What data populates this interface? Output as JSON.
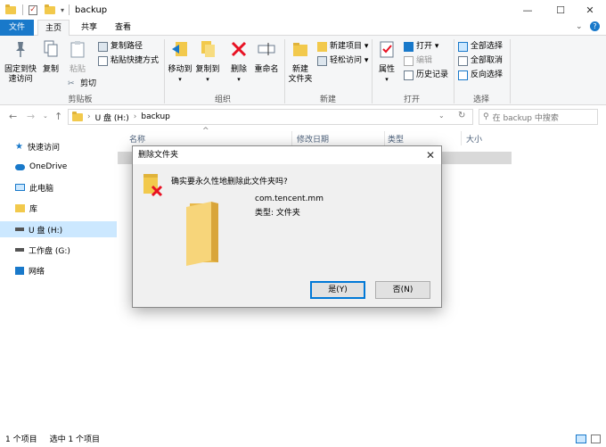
{
  "window": {
    "title": "backup",
    "controls": {
      "minimize": "—",
      "maximize": "☐",
      "close": "✕"
    }
  },
  "ribbon_tabs": {
    "file": "文件",
    "home": "主页",
    "share": "共享",
    "view": "查看"
  },
  "ribbon": {
    "clipboard": {
      "pin": "固定到快\n速访问",
      "copy": "复制",
      "paste": "粘贴",
      "cut": "剪切",
      "copy_path": "复制路径",
      "paste_shortcut": "粘贴快捷方式",
      "label": "剪贴板"
    },
    "organize": {
      "move_to": "移动到",
      "copy_to": "复制到",
      "delete": "删除",
      "rename": "重命名",
      "label": "组织"
    },
    "new": {
      "new_folder": "新建\n文件夹",
      "new_item": "新建项目 ▾",
      "easy_access": "轻松访问 ▾",
      "label": "新建"
    },
    "open": {
      "properties": "属性",
      "open": "打开 ▾",
      "edit": "编辑",
      "history": "历史记录",
      "label": "打开"
    },
    "select": {
      "select_all": "全部选择",
      "select_none": "全部取消",
      "invert": "反向选择",
      "label": "选择"
    }
  },
  "address": {
    "segments": [
      "U 盘 (H:)",
      "backup"
    ],
    "search_placeholder": "在 backup 中搜索"
  },
  "nav_pane": {
    "items": [
      {
        "label": "快速访问",
        "icon": "star-icon"
      },
      {
        "label": "OneDrive",
        "icon": "cloud-icon"
      },
      {
        "label": "此电脑",
        "icon": "computer-icon"
      },
      {
        "label": "库",
        "icon": "library-icon"
      },
      {
        "label": "U 盘 (H:)",
        "icon": "drive-icon"
      },
      {
        "label": "工作盘 (G:)",
        "icon": "drive-icon"
      },
      {
        "label": "网络",
        "icon": "network-icon"
      }
    ]
  },
  "columns": {
    "name": "名称",
    "modified": "修改日期",
    "type": "类型",
    "size": "大小"
  },
  "status": {
    "count": "1 个项目",
    "selected": "选中 1 个项目"
  },
  "dialog": {
    "title": "删除文件夹",
    "question": "确实要永久性地删除此文件夹吗?",
    "folder_name": "com.tencent.mm",
    "folder_type": "类型: 文件夹",
    "yes": "是(Y)",
    "no": "否(N)"
  },
  "colors": {
    "accent": "#1979ca",
    "folder": "#f2c94c",
    "selection": "#cce8ff",
    "delete_red": "#e81123"
  }
}
